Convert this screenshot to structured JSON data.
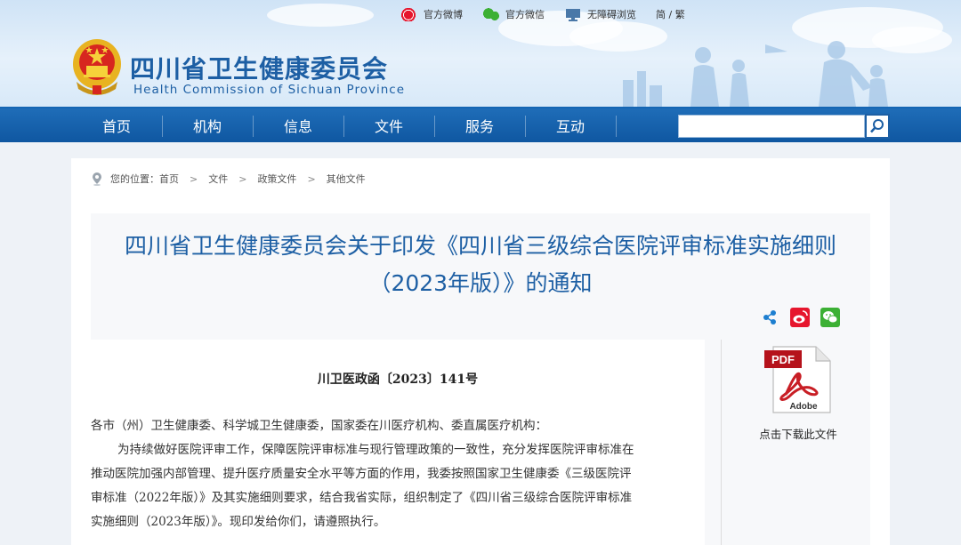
{
  "topbar": {
    "weibo": "官方微博",
    "wechat": "官方微信",
    "accessible": "无障碍浏览",
    "lang": "简 / 繁"
  },
  "site": {
    "name_cn": "四川省卫生健康委员会",
    "name_en": "Health Commission of Sichuan Province"
  },
  "nav": {
    "items": [
      "首页",
      "机构",
      "信息",
      "文件",
      "服务",
      "互动"
    ],
    "search_placeholder": ""
  },
  "breadcrumb": {
    "prefix": "您的位置：",
    "items": [
      "首页",
      "文件",
      "政策文件",
      "其他文件"
    ],
    "separator": ">"
  },
  "article": {
    "title_line1": "四川省卫生健康委员会关于印发《四川省三级综合医院评审标准实施细则",
    "title_line2": "（2023年版）》的通知",
    "doc_number": "川卫医政函〔2023〕141号",
    "salutation": "各市（州）卫生健康委、科学城卫生健康委，国家委在川医疗机构、委直属医疗机构：",
    "body_lines": [
      "为持续做好医院评审工作，保障医院评审标准与现行管理政策的一致性，充分发挥医院评审标准在",
      "推动医院加强内部管理、提升医疗质量安全水平等方面的作用，我委按照国家卫生健康委《三级医院评",
      "审标准（2022年版）》及其实施细则要求，结合我省实际，组织制定了《四川省三级综合医院评审标准",
      "实施细则（2023年版）》。现印发给你们，请遵照执行。"
    ]
  },
  "attachment": {
    "badge": "PDF",
    "brand": "Adobe",
    "label": "点击下载此文件"
  },
  "colors": {
    "brand_blue": "#1d5fa4",
    "nav_blue": "#0f57a1",
    "weibo_red": "#e6162d",
    "wechat_green": "#3cb034"
  }
}
